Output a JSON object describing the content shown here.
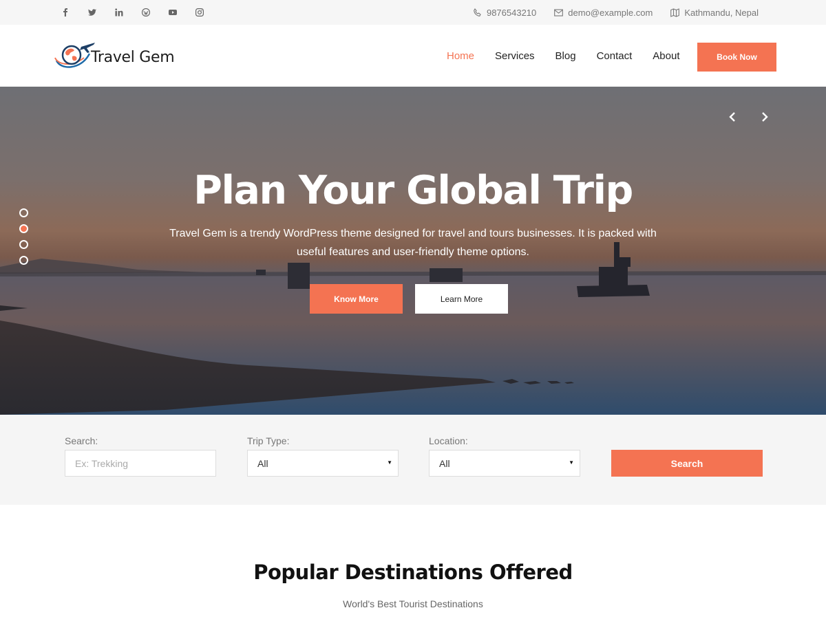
{
  "topbar": {
    "social": [
      "facebook-icon",
      "twitter-icon",
      "linkedin-icon",
      "wordpress-icon",
      "youtube-icon",
      "instagram-icon"
    ],
    "phone": "9876543210",
    "email": "demo@example.com",
    "location": "Kathmandu, Nepal"
  },
  "header": {
    "logo_text": "Travel Gem",
    "nav": [
      "Home",
      "Services",
      "Blog",
      "Contact",
      "About"
    ],
    "active_nav": "Home",
    "book_label": "Book Now"
  },
  "hero": {
    "title": "Plan Your Global Trip",
    "description": "Travel Gem is a trendy WordPress theme designed for travel and tours businesses. It is packed with useful features and user-friendly theme options.",
    "primary_button": "Know More",
    "secondary_button": "Learn More",
    "slide_count": 4,
    "active_slide": 2
  },
  "search": {
    "search_label": "Search:",
    "search_placeholder": "Ex: Trekking",
    "trip_type_label": "Trip Type:",
    "trip_type_value": "All",
    "location_label": "Location:",
    "location_value": "All",
    "button_label": "Search"
  },
  "destinations": {
    "title": "Popular Destinations Offered",
    "subtitle": "World's Best Tourist Destinations"
  },
  "colors": {
    "accent": "#f47352",
    "topbar_bg": "#f6f6f6",
    "search_bg": "#f5f5f5"
  }
}
